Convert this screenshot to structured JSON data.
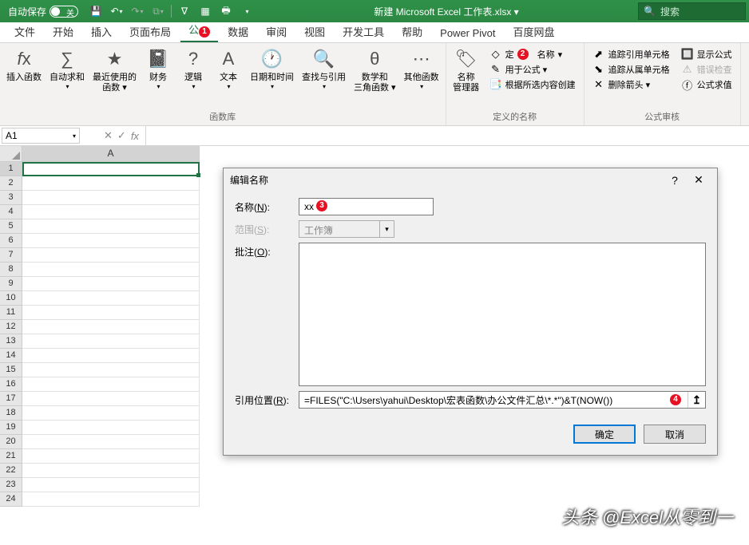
{
  "titlebar": {
    "autosave_label": "自动保存",
    "toggle_state": "关",
    "doc_title": "新建 Microsoft Excel 工作表.xlsx ▾",
    "search_placeholder": "搜索"
  },
  "tabs": [
    "文件",
    "开始",
    "插入",
    "页面布局",
    "公式",
    "数据",
    "审阅",
    "视图",
    "开发工具",
    "帮助",
    "Power Pivot",
    "百度网盘"
  ],
  "ribbon": {
    "group1_label": "",
    "insert_function": "插入函数",
    "autosum": "自动求和",
    "recent": "最近使用的\n函数 ▾",
    "financial": "财务",
    "logical": "逻辑",
    "text": "文本",
    "datetime": "日期和时间",
    "lookup": "查找与引用",
    "math": "数学和\n三角函数 ▾",
    "more": "其他函数",
    "lib_label": "函数库",
    "name_manager": "名称\n管理器",
    "define_name": "名称",
    "use_in_formula": "用于公式 ▾",
    "create_from_sel": "根据所选内容创建",
    "defined_label": "定义的名称",
    "trace_prec": "追踪引用单元格",
    "trace_dep": "追踪从属单元格",
    "remove_arrows": "删除箭头 ▾",
    "show_formulas": "显示公式",
    "error_check": "错误检查",
    "eval_formula": "公式求值",
    "audit_label": "公式审核"
  },
  "namebox": {
    "cell_ref": "A1",
    "fx_label": "fx"
  },
  "columns": [
    "A"
  ],
  "dialog": {
    "title": "编辑名称",
    "name_label": "名称(N):",
    "name_value": "xx",
    "scope_label": "范围(S):",
    "scope_value": "工作簿",
    "comment_label": "批注(O):",
    "refers_label": "引用位置(R):",
    "refers_value": "=FILES(\"C:\\Users\\yahui\\Desktop\\宏表函数\\办公文件汇总\\*.*\")&T(NOW())",
    "ok": "确定",
    "cancel": "取消"
  },
  "badges": {
    "b1": "1",
    "b2": "2",
    "b3": "3",
    "b4": "4"
  },
  "watermark": "头条 @Excel从零到一"
}
